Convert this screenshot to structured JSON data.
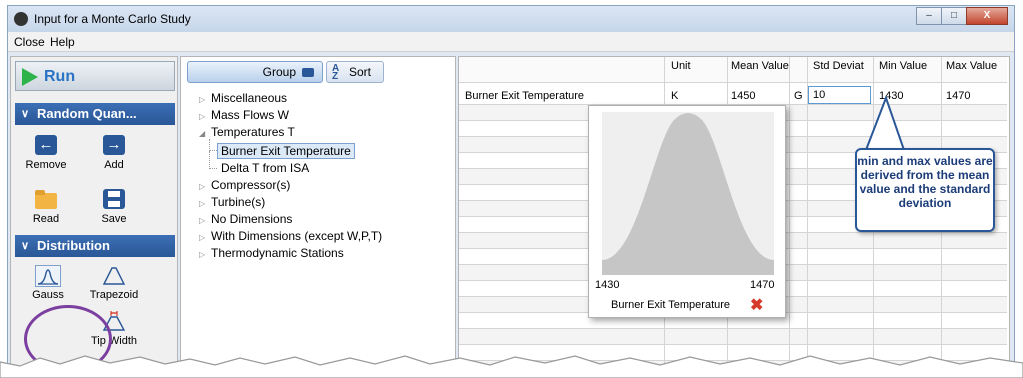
{
  "window": {
    "title": "Input for a Monte Carlo Study",
    "buttons": [
      "–",
      "□",
      "X"
    ]
  },
  "menu": [
    "Close",
    "Help"
  ],
  "left_panel": {
    "run_label": "Run",
    "random_section": "Random Quan...",
    "tools": {
      "remove": "Remove",
      "add": "Add",
      "read": "Read",
      "save": "Save"
    },
    "distribution_section": "Distribution",
    "distributions": {
      "gauss": "Gauss",
      "trapezoid": "Trapezoid",
      "tip_width": "Tip Width"
    }
  },
  "middle_panel": {
    "group_label": "Group",
    "sort_label": "Sort",
    "tree": [
      {
        "label": "Miscellaneous",
        "expanded": false
      },
      {
        "label": "Mass Flows W",
        "expanded": false
      },
      {
        "label": "Temperatures T",
        "expanded": true
      },
      {
        "label": "Burner Exit Temperature",
        "child": true,
        "selected": true
      },
      {
        "label": "Delta T from ISA",
        "child": true
      },
      {
        "label": "Compressor(s)",
        "expanded": false
      },
      {
        "label": "Turbine(s)",
        "expanded": false
      },
      {
        "label": "No Dimensions",
        "expanded": false
      },
      {
        "label": "With Dimensions (except W,P,T)",
        "expanded": false
      },
      {
        "label": "Thermodynamic Stations",
        "expanded": false
      }
    ]
  },
  "grid": {
    "headers": {
      "unit": "Unit",
      "mean": "Mean Value",
      "std": "Std Deviat",
      "min": "Min Value",
      "max": "Max Value"
    },
    "row": {
      "name": "Burner Exit Temperature",
      "unit": "K",
      "mean": "1450",
      "dist": "G",
      "std": "10",
      "min": "1430",
      "max": "1470"
    }
  },
  "popup": {
    "x_min": "1430",
    "x_max": "1470",
    "caption": "Burner Exit Temperature"
  },
  "callout": {
    "text": "min and max values are derived from the mean value and the standard deviation"
  }
}
